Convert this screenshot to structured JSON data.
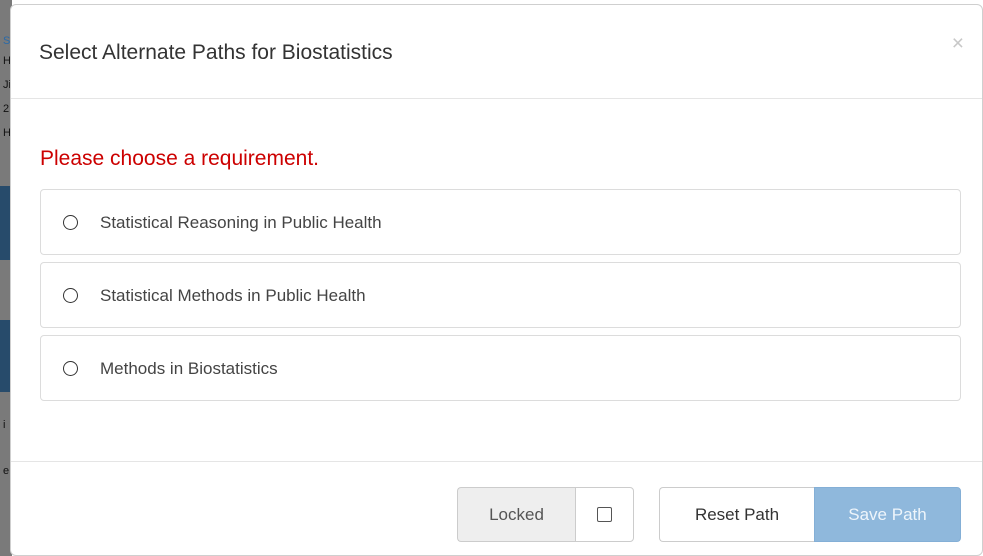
{
  "background_page": {
    "visible_fragments": [
      "S",
      "H",
      "Ji",
      "2",
      "H",
      "i",
      "e"
    ]
  },
  "modal": {
    "title": "Select Alternate Paths for Biostatistics",
    "close_glyph": "×",
    "prompt": "Please choose a requirement.",
    "options": [
      {
        "label": "Statistical Reasoning in Public Health",
        "selected": false
      },
      {
        "label": "Statistical Methods in Public Health",
        "selected": false
      },
      {
        "label": "Methods in Biostatistics",
        "selected": false
      }
    ],
    "footer": {
      "locked_label": "Locked",
      "locked_checked": false,
      "reset_button": "Reset Path",
      "save_button": "Save Path",
      "save_enabled": false
    }
  },
  "colors": {
    "prompt_text": "#cc0000",
    "save_button_disabled": "#8fb8dc",
    "locked_addon_bg": "#eeeeee"
  }
}
